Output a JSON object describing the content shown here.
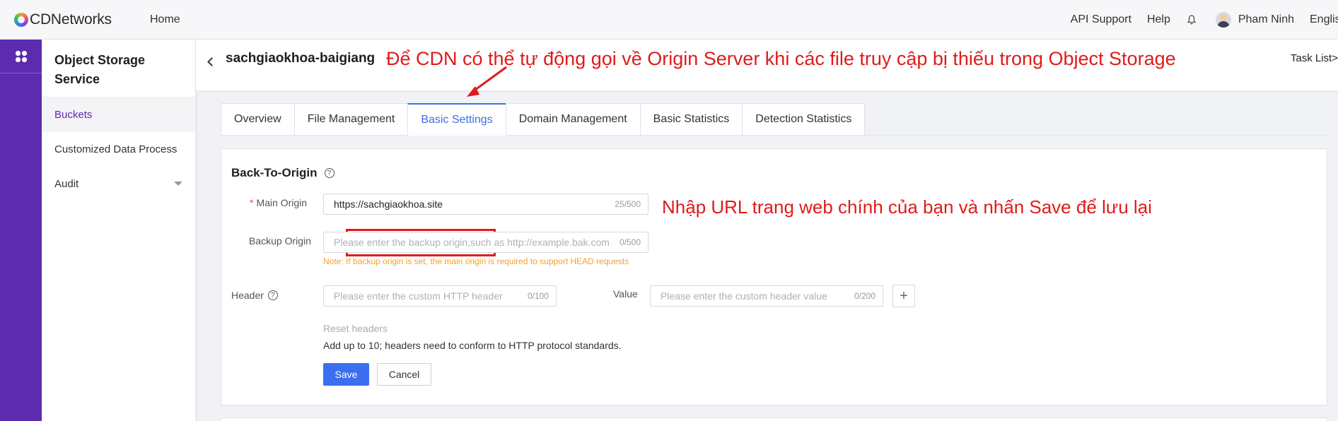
{
  "topbar": {
    "brand": "CDNetworks",
    "home_label": "Home",
    "api_support": "API Support",
    "help": "Help",
    "user_name": "Pham Ninh",
    "language": "English"
  },
  "sidebar": {
    "service_title": "Object Storage Service",
    "items": [
      {
        "label": "Buckets"
      },
      {
        "label": "Customized Data Process"
      },
      {
        "label": "Audit"
      }
    ]
  },
  "header": {
    "bucket_name": "sachgiaokhoa-baigiang",
    "task_list": "Task List>"
  },
  "annotations": {
    "top_note": "Để CDN có thể tự động gọi về Origin Server khi các file truy cập bị thiếu trong Object Storage",
    "right_note": "Nhập URL trang web chính của bạn và nhấn Save để lưu lại",
    "color": "#e01b1b"
  },
  "tabs": [
    {
      "label": "Overview"
    },
    {
      "label": "File Management"
    },
    {
      "label": "Basic Settings"
    },
    {
      "label": "Domain Management"
    },
    {
      "label": "Basic Statistics"
    },
    {
      "label": "Detection Statistics"
    }
  ],
  "form": {
    "section_title": "Back-To-Origin",
    "main_origin": {
      "label": "Main Origin",
      "required_mark": "*",
      "value": "https://sachgiaokhoa.site",
      "counter": "25/500"
    },
    "backup_origin": {
      "label": "Backup Origin",
      "placeholder": "Please enter the backup origin,such as http://example.bak.com",
      "counter": "0/500",
      "note": "Note: If backup origin is set, the main origin is required to support HEAD requests"
    },
    "header": {
      "label": "Header",
      "placeholder": "Please enter the custom HTTP header",
      "counter": "0/100"
    },
    "value": {
      "label": "Value",
      "placeholder": "Please enter the custom header value",
      "counter": "0/200"
    },
    "add_symbol": "+",
    "reset_headers": "Reset headers",
    "hint": "Add up to 10; headers need to conform to HTTP protocol standards.",
    "save_label": "Save",
    "cancel_label": "Cancel"
  },
  "colors": {
    "brand_purple": "#5b2bb0",
    "primary_blue": "#3b6ff0",
    "note_orange": "#f0a030"
  }
}
